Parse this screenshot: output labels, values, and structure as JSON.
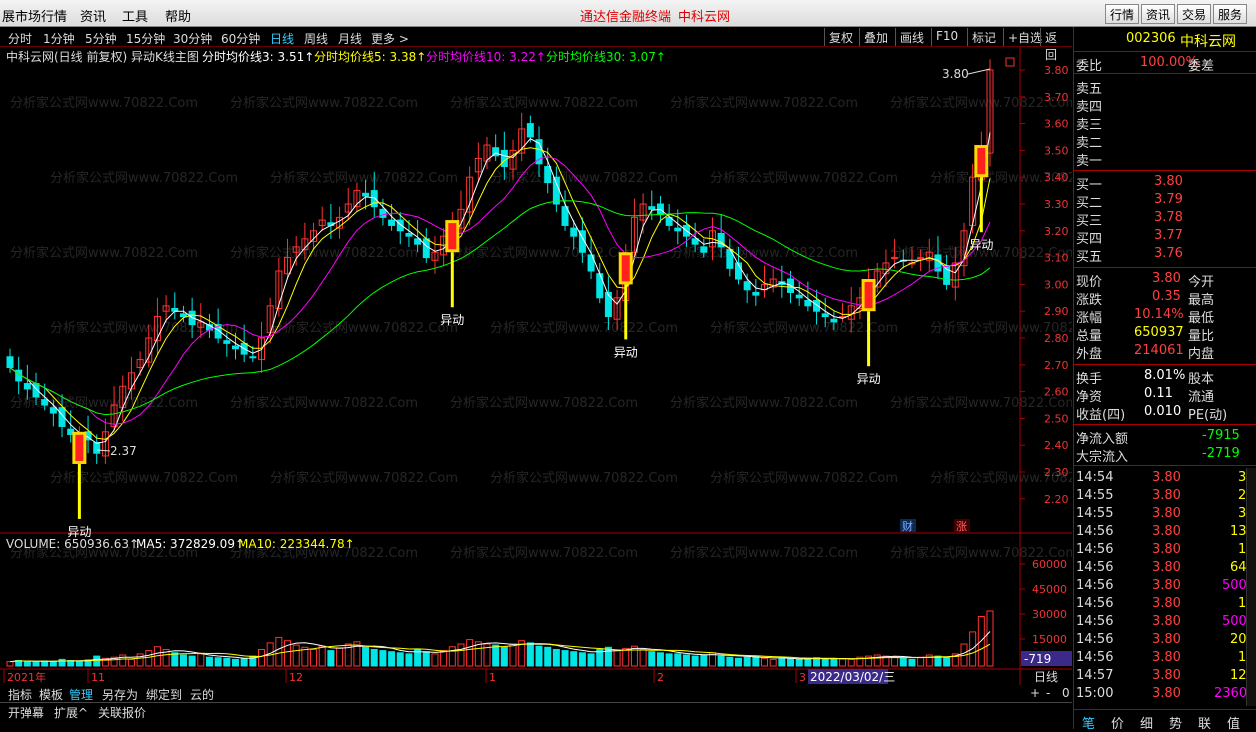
{
  "menu": {
    "items": [
      "展市场行情",
      "资讯",
      "工具",
      "帮助"
    ],
    "title": "通达信金融终端",
    "title2": "中科云网",
    "right": [
      "行情",
      "资讯",
      "交易",
      "服务"
    ]
  },
  "periods": [
    "分时",
    "1分钟",
    "5分钟",
    "15分钟",
    "30分钟",
    "60分钟",
    "日线",
    "周线",
    "月线",
    "更多 >"
  ],
  "active_period": "日线",
  "toolbar_right": [
    "复权",
    "叠加",
    "画线",
    "F10",
    "标记",
    "+自选",
    "返回"
  ],
  "chart": {
    "header": "中科云网(日线 前复权) 异动K线主图",
    "ma3_label": "分时均价线3: 3.51↑",
    "ma5_label": "分时均价线5: 3.38↑",
    "ma10_label": "分时均价线10: 3.22↑",
    "ma30_label": "分时均价线30: 3.07↑",
    "colors": {
      "up": "#ff3232",
      "down": "#00e5e5",
      "ma3": "#ffffff",
      "ma5": "#ffff00",
      "ma10": "#ff00ff",
      "ma30": "#00ff00",
      "signal": "#ffff00"
    },
    "price_axis": [
      "3.80",
      "3.70",
      "3.60",
      "3.50",
      "3.40",
      "3.30",
      "3.20",
      "3.10",
      "3.00",
      "2.90",
      "2.80",
      "2.70",
      "2.60",
      "2.50",
      "2.40",
      "2.30",
      "2.20"
    ],
    "high_label": "3.80",
    "low_label": "2.37",
    "signal_label": "异动",
    "events": [
      "财",
      "涨"
    ],
    "watermark": "分析家公式网www.70822.Com"
  },
  "volume": {
    "header": "VOLUME: 650936.63↑",
    "ma5_label": "MA5: 372829.09↑",
    "ma10_label": "MA10: 223344.78↑",
    "axis": [
      "60000",
      "45000",
      "30000",
      "15000"
    ],
    "cursor_value": "-719"
  },
  "dates": {
    "labels": [
      "2021年",
      "11",
      "12",
      "1",
      "2",
      "3"
    ],
    "cursor": "2022/03/02/三",
    "period": "日线"
  },
  "bottom": {
    "tabs": [
      "指标",
      "模板",
      "管理",
      "另存为",
      "绑定到",
      "云的"
    ],
    "tabs2": [
      "开弹幕",
      "扩展^",
      "关联报价"
    ],
    "controls": [
      "+",
      "-",
      "0"
    ]
  },
  "quote": {
    "code": "002306",
    "name": "中科云网",
    "weibi_label": "委比",
    "weibi": "100.00%",
    "weicha_label": "委差",
    "sells": [
      "卖五",
      "卖四",
      "卖三",
      "卖二",
      "卖一"
    ],
    "buys": [
      {
        "l": "买一",
        "p": "3.80"
      },
      {
        "l": "买二",
        "p": "3.79"
      },
      {
        "l": "买三",
        "p": "3.78"
      },
      {
        "l": "买四",
        "p": "3.77"
      },
      {
        "l": "买五",
        "p": "3.76"
      }
    ],
    "stats": [
      {
        "l": "现价",
        "v": "3.80",
        "r": "今开",
        "c": "#ff4040"
      },
      {
        "l": "涨跌",
        "v": "0.35",
        "r": "最高",
        "c": "#ff4040"
      },
      {
        "l": "涨幅",
        "v": "10.14%",
        "r": "最低",
        "c": "#ff4040"
      },
      {
        "l": "总量",
        "v": "650937",
        "r": "量比",
        "c": "#ffff00"
      },
      {
        "l": "外盘",
        "v": "214061",
        "r": "内盘",
        "c": "#ff4040"
      }
    ],
    "stats2": [
      {
        "l": "换手",
        "v": "8.01%",
        "r": "股本"
      },
      {
        "l": "净资",
        "v": "0.11",
        "r": "流通"
      },
      {
        "l": "收益(四)",
        "v": "0.010",
        "r": "PE(动)"
      }
    ],
    "flow": [
      {
        "l": "净流入额",
        "v": "-7915"
      },
      {
        "l": "大宗流入",
        "v": "-2719"
      }
    ],
    "ticks": [
      {
        "t": "14:54",
        "p": "3.80",
        "v": "3",
        "c": "#ffff00"
      },
      {
        "t": "14:55",
        "p": "3.80",
        "v": "2",
        "c": "#ffff00"
      },
      {
        "t": "14:55",
        "p": "3.80",
        "v": "3",
        "c": "#ffff00"
      },
      {
        "t": "14:56",
        "p": "3.80",
        "v": "13",
        "c": "#ffff00"
      },
      {
        "t": "14:56",
        "p": "3.80",
        "v": "1",
        "c": "#ffff00"
      },
      {
        "t": "14:56",
        "p": "3.80",
        "v": "64",
        "c": "#ffff00"
      },
      {
        "t": "14:56",
        "p": "3.80",
        "v": "500",
        "c": "#ff00ff"
      },
      {
        "t": "14:56",
        "p": "3.80",
        "v": "1",
        "c": "#ffff00"
      },
      {
        "t": "14:56",
        "p": "3.80",
        "v": "500",
        "c": "#ff00ff"
      },
      {
        "t": "14:56",
        "p": "3.80",
        "v": "20",
        "c": "#ffff00"
      },
      {
        "t": "14:56",
        "p": "3.80",
        "v": "1",
        "c": "#ffff00"
      },
      {
        "t": "14:57",
        "p": "3.80",
        "v": "12",
        "c": "#ffff00"
      },
      {
        "t": "15:00",
        "p": "3.80",
        "v": "2360",
        "c": "#ff00ff"
      }
    ],
    "bottom_tabs": [
      "笔",
      "价",
      "细",
      "势",
      "联",
      "值"
    ]
  }
}
